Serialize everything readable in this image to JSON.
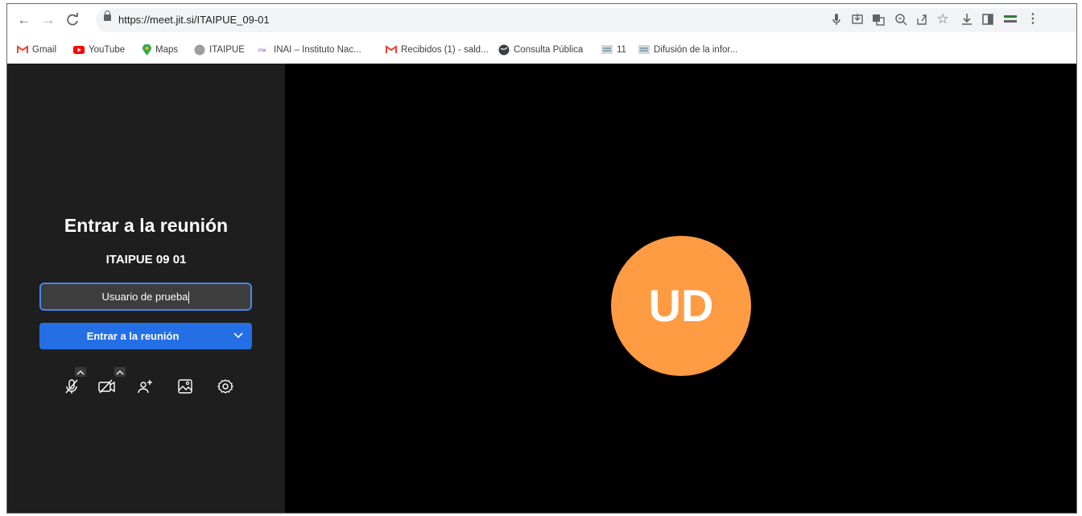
{
  "browser": {
    "url": "https://meet.jit.si/ITAIPUE_09-01",
    "bookmarks": [
      {
        "label": "Gmail",
        "icon": "gmail-icon"
      },
      {
        "label": "YouTube",
        "icon": "youtube-icon"
      },
      {
        "label": "Maps",
        "icon": "maps-icon"
      },
      {
        "label": "ITAIPUE",
        "icon": "globe-gray-icon"
      },
      {
        "label": "INAI – Instituto Nac...",
        "icon": "inai-icon"
      },
      {
        "label": "Recibidos (1) - sald...",
        "icon": "gmail-icon"
      },
      {
        "label": "Consulta Pública",
        "icon": "globe-icon"
      },
      {
        "label": "11",
        "icon": "doc-icon"
      },
      {
        "label": "Difusión de la infor...",
        "icon": "doc-icon"
      }
    ]
  },
  "prejoin": {
    "title": "Entrar a la reunión",
    "room_name": "ITAIPUE 09 01",
    "name_input_value": "Usuario de prueba",
    "join_button_label": "Entrar a la reunión"
  },
  "avatar": {
    "initials": "UD",
    "color": "#ff9b42"
  },
  "colors": {
    "panel_bg": "#1e1e1e",
    "join_button": "#246fe5",
    "input_border": "#4687ed"
  }
}
